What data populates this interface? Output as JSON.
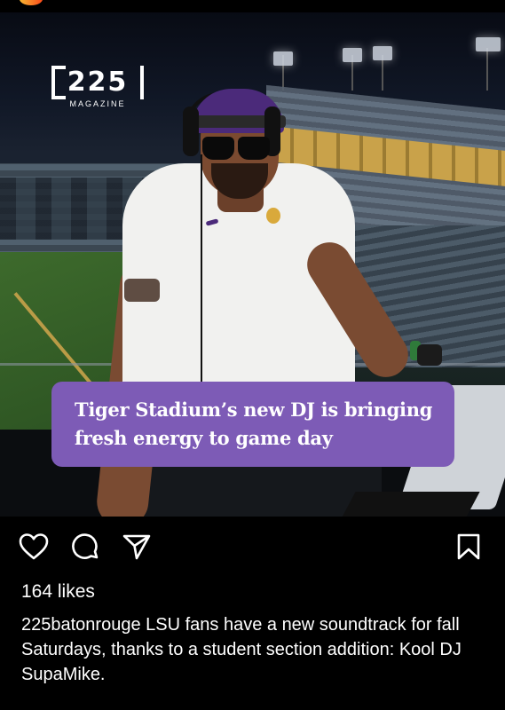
{
  "post": {
    "brand": {
      "number": "225",
      "sub": "MAGAZINE"
    },
    "banner": {
      "line1": "Tiger Stadium’s new DJ is bringing",
      "line2": "fresh energy to game day"
    },
    "actions": {
      "like_icon": "heart-icon",
      "comment_icon": "comment-icon",
      "share_icon": "send-icon",
      "save_icon": "bookmark-icon"
    },
    "likes": "164 likes",
    "caption": {
      "username": "225batonrouge",
      "text": " LSU fans have a new soundtrack for fall Saturdays, thanks to a student section addition: Kool DJ SupaMike."
    }
  },
  "colors": {
    "background": "#000000",
    "banner": "#7d5bb6",
    "text": "#ffffff"
  }
}
